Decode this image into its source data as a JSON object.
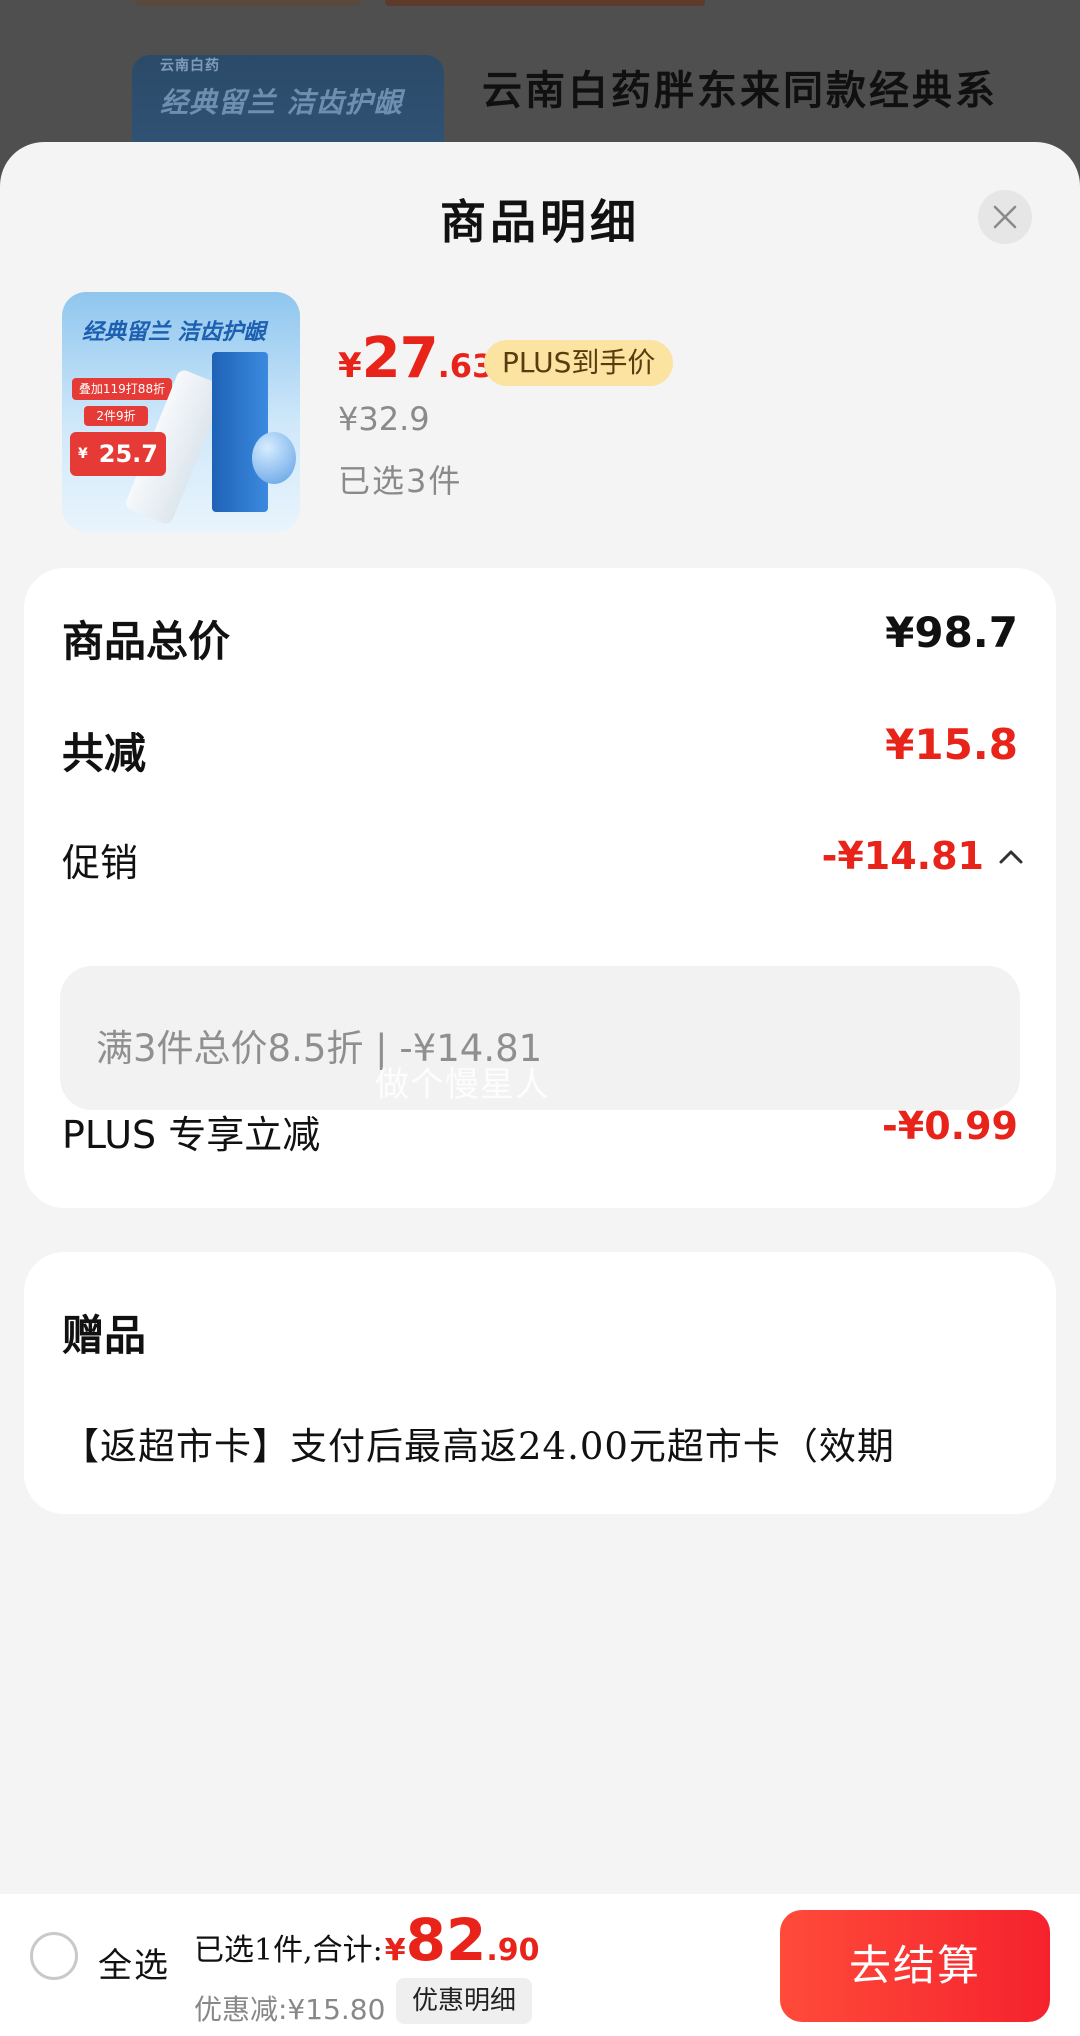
{
  "background": {
    "thumb_top_text": "云南白药",
    "thumb_text": "经典留兰 洁齿护龈",
    "title": "云南白药胖东来同款经典系"
  },
  "sheet": {
    "title": "商品明细",
    "close_icon": "close-icon"
  },
  "product": {
    "image_header": "经典留兰 洁齿护龈",
    "image_tag1": "叠加119打88折",
    "image_tag2": "2件9折",
    "image_price": "25.7",
    "price_symbol": "¥",
    "price_int": "27",
    "price_dec": ".63",
    "plus_badge": "PLUS到手价",
    "original_price": "¥32.9",
    "selected_count": "已选3件"
  },
  "summary": {
    "total_label": "商品总价",
    "total_value": "¥98.7",
    "reduce_label": "共减",
    "reduce_value": "¥15.8",
    "promo_label": "促销",
    "promo_value": "-¥14.81",
    "promo_detail": "满3件总价8.5折 | -¥14.81",
    "plus_label": "PLUS 专享立减",
    "plus_value": "-¥0.99"
  },
  "watermark": "做个慢星人",
  "gift": {
    "title": "赠品",
    "text": "【返超市卡】支付后最高返24.00元超市卡（效期"
  },
  "bottom_bar": {
    "select_all": "全选",
    "total_label": "已选1件,合计:",
    "total_symbol": "¥",
    "total_int": "82",
    "total_dec": ".90",
    "discount_text": "优惠减:¥15.80",
    "discount_detail_button": "优惠明细",
    "checkout_button": "去结算"
  },
  "colors": {
    "accent_red": "#e8231a",
    "plus_badge_bg": "#fbe3a2",
    "checkout_gradient_start": "#ff4b3a",
    "checkout_gradient_end": "#f5222d"
  }
}
